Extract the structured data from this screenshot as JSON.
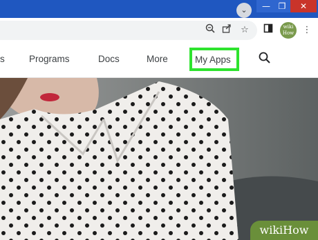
{
  "browser": {
    "profile_badge": "wiki How"
  },
  "nav": {
    "items": [
      "s",
      "Programs",
      "Docs",
      "More"
    ],
    "my_apps": "My Apps"
  },
  "watermark": "wikiHow",
  "colors": {
    "titlebar": "#1f57c0",
    "highlight": "#2ee32e",
    "watermark": "#6a8f3a"
  }
}
